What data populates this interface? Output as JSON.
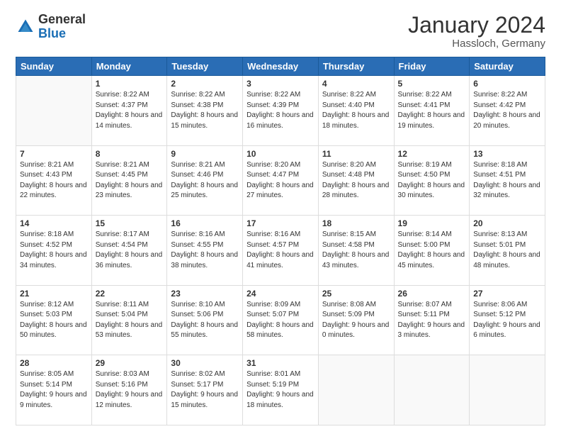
{
  "header": {
    "logo_general": "General",
    "logo_blue": "Blue",
    "title": "January 2024",
    "location": "Hassloch, Germany"
  },
  "columns": [
    "Sunday",
    "Monday",
    "Tuesday",
    "Wednesday",
    "Thursday",
    "Friday",
    "Saturday"
  ],
  "weeks": [
    [
      {
        "day": "",
        "sunrise": "",
        "sunset": "",
        "daylight": ""
      },
      {
        "day": "1",
        "sunrise": "Sunrise: 8:22 AM",
        "sunset": "Sunset: 4:37 PM",
        "daylight": "Daylight: 8 hours and 14 minutes."
      },
      {
        "day": "2",
        "sunrise": "Sunrise: 8:22 AM",
        "sunset": "Sunset: 4:38 PM",
        "daylight": "Daylight: 8 hours and 15 minutes."
      },
      {
        "day": "3",
        "sunrise": "Sunrise: 8:22 AM",
        "sunset": "Sunset: 4:39 PM",
        "daylight": "Daylight: 8 hours and 16 minutes."
      },
      {
        "day": "4",
        "sunrise": "Sunrise: 8:22 AM",
        "sunset": "Sunset: 4:40 PM",
        "daylight": "Daylight: 8 hours and 18 minutes."
      },
      {
        "day": "5",
        "sunrise": "Sunrise: 8:22 AM",
        "sunset": "Sunset: 4:41 PM",
        "daylight": "Daylight: 8 hours and 19 minutes."
      },
      {
        "day": "6",
        "sunrise": "Sunrise: 8:22 AM",
        "sunset": "Sunset: 4:42 PM",
        "daylight": "Daylight: 8 hours and 20 minutes."
      }
    ],
    [
      {
        "day": "7",
        "sunrise": "Sunrise: 8:21 AM",
        "sunset": "Sunset: 4:43 PM",
        "daylight": "Daylight: 8 hours and 22 minutes."
      },
      {
        "day": "8",
        "sunrise": "Sunrise: 8:21 AM",
        "sunset": "Sunset: 4:45 PM",
        "daylight": "Daylight: 8 hours and 23 minutes."
      },
      {
        "day": "9",
        "sunrise": "Sunrise: 8:21 AM",
        "sunset": "Sunset: 4:46 PM",
        "daylight": "Daylight: 8 hours and 25 minutes."
      },
      {
        "day": "10",
        "sunrise": "Sunrise: 8:20 AM",
        "sunset": "Sunset: 4:47 PM",
        "daylight": "Daylight: 8 hours and 27 minutes."
      },
      {
        "day": "11",
        "sunrise": "Sunrise: 8:20 AM",
        "sunset": "Sunset: 4:48 PM",
        "daylight": "Daylight: 8 hours and 28 minutes."
      },
      {
        "day": "12",
        "sunrise": "Sunrise: 8:19 AM",
        "sunset": "Sunset: 4:50 PM",
        "daylight": "Daylight: 8 hours and 30 minutes."
      },
      {
        "day": "13",
        "sunrise": "Sunrise: 8:18 AM",
        "sunset": "Sunset: 4:51 PM",
        "daylight": "Daylight: 8 hours and 32 minutes."
      }
    ],
    [
      {
        "day": "14",
        "sunrise": "Sunrise: 8:18 AM",
        "sunset": "Sunset: 4:52 PM",
        "daylight": "Daylight: 8 hours and 34 minutes."
      },
      {
        "day": "15",
        "sunrise": "Sunrise: 8:17 AM",
        "sunset": "Sunset: 4:54 PM",
        "daylight": "Daylight: 8 hours and 36 minutes."
      },
      {
        "day": "16",
        "sunrise": "Sunrise: 8:16 AM",
        "sunset": "Sunset: 4:55 PM",
        "daylight": "Daylight: 8 hours and 38 minutes."
      },
      {
        "day": "17",
        "sunrise": "Sunrise: 8:16 AM",
        "sunset": "Sunset: 4:57 PM",
        "daylight": "Daylight: 8 hours and 41 minutes."
      },
      {
        "day": "18",
        "sunrise": "Sunrise: 8:15 AM",
        "sunset": "Sunset: 4:58 PM",
        "daylight": "Daylight: 8 hours and 43 minutes."
      },
      {
        "day": "19",
        "sunrise": "Sunrise: 8:14 AM",
        "sunset": "Sunset: 5:00 PM",
        "daylight": "Daylight: 8 hours and 45 minutes."
      },
      {
        "day": "20",
        "sunrise": "Sunrise: 8:13 AM",
        "sunset": "Sunset: 5:01 PM",
        "daylight": "Daylight: 8 hours and 48 minutes."
      }
    ],
    [
      {
        "day": "21",
        "sunrise": "Sunrise: 8:12 AM",
        "sunset": "Sunset: 5:03 PM",
        "daylight": "Daylight: 8 hours and 50 minutes."
      },
      {
        "day": "22",
        "sunrise": "Sunrise: 8:11 AM",
        "sunset": "Sunset: 5:04 PM",
        "daylight": "Daylight: 8 hours and 53 minutes."
      },
      {
        "day": "23",
        "sunrise": "Sunrise: 8:10 AM",
        "sunset": "Sunset: 5:06 PM",
        "daylight": "Daylight: 8 hours and 55 minutes."
      },
      {
        "day": "24",
        "sunrise": "Sunrise: 8:09 AM",
        "sunset": "Sunset: 5:07 PM",
        "daylight": "Daylight: 8 hours and 58 minutes."
      },
      {
        "day": "25",
        "sunrise": "Sunrise: 8:08 AM",
        "sunset": "Sunset: 5:09 PM",
        "daylight": "Daylight: 9 hours and 0 minutes."
      },
      {
        "day": "26",
        "sunrise": "Sunrise: 8:07 AM",
        "sunset": "Sunset: 5:11 PM",
        "daylight": "Daylight: 9 hours and 3 minutes."
      },
      {
        "day": "27",
        "sunrise": "Sunrise: 8:06 AM",
        "sunset": "Sunset: 5:12 PM",
        "daylight": "Daylight: 9 hours and 6 minutes."
      }
    ],
    [
      {
        "day": "28",
        "sunrise": "Sunrise: 8:05 AM",
        "sunset": "Sunset: 5:14 PM",
        "daylight": "Daylight: 9 hours and 9 minutes."
      },
      {
        "day": "29",
        "sunrise": "Sunrise: 8:03 AM",
        "sunset": "Sunset: 5:16 PM",
        "daylight": "Daylight: 9 hours and 12 minutes."
      },
      {
        "day": "30",
        "sunrise": "Sunrise: 8:02 AM",
        "sunset": "Sunset: 5:17 PM",
        "daylight": "Daylight: 9 hours and 15 minutes."
      },
      {
        "day": "31",
        "sunrise": "Sunrise: 8:01 AM",
        "sunset": "Sunset: 5:19 PM",
        "daylight": "Daylight: 9 hours and 18 minutes."
      },
      {
        "day": "",
        "sunrise": "",
        "sunset": "",
        "daylight": ""
      },
      {
        "day": "",
        "sunrise": "",
        "sunset": "",
        "daylight": ""
      },
      {
        "day": "",
        "sunrise": "",
        "sunset": "",
        "daylight": ""
      }
    ]
  ]
}
